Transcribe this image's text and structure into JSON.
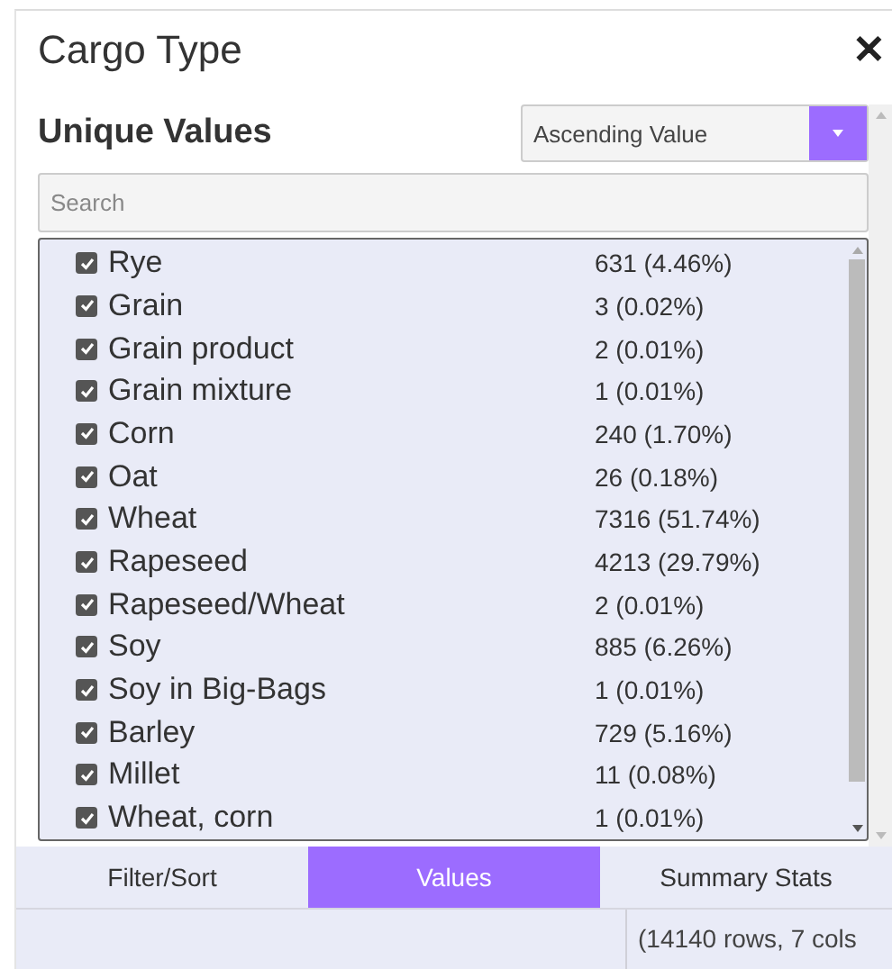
{
  "window": {
    "title": "Cargo Type",
    "close": "✕"
  },
  "header": {
    "title": "Unique Values",
    "sort": {
      "value": "Ascending Value"
    }
  },
  "search": {
    "placeholder": "Search"
  },
  "values": [
    {
      "label": "Rye",
      "count": "631 (4.46%)",
      "checked": true
    },
    {
      "label": "Grain",
      "count": "3 (0.02%)",
      "checked": true
    },
    {
      "label": "Grain product",
      "count": "2 (0.01%)",
      "checked": true
    },
    {
      "label": "Grain mixture",
      "count": "1 (0.01%)",
      "checked": true
    },
    {
      "label": "Corn",
      "count": "240 (1.70%)",
      "checked": true
    },
    {
      "label": "Oat",
      "count": "26 (0.18%)",
      "checked": true
    },
    {
      "label": "Wheat",
      "count": "7316 (51.74%)",
      "checked": true
    },
    {
      "label": "Rapeseed",
      "count": "4213 (29.79%)",
      "checked": true
    },
    {
      "label": "Rapeseed/Wheat",
      "count": "2 (0.01%)",
      "checked": true
    },
    {
      "label": "Soy",
      "count": "885 (6.26%)",
      "checked": true
    },
    {
      "label": "Soy in Big-Bags",
      "count": "1 (0.01%)",
      "checked": true
    },
    {
      "label": "Barley",
      "count": "729 (5.16%)",
      "checked": true
    },
    {
      "label": "Millet",
      "count": "11 (0.08%)",
      "checked": true
    },
    {
      "label": "Wheat, corn",
      "count": "1 (0.01%)",
      "checked": true
    }
  ],
  "tabs": [
    {
      "label": "Filter/Sort",
      "selected": false
    },
    {
      "label": "Values",
      "selected": true
    },
    {
      "label": "Summary Stats",
      "selected": false
    }
  ],
  "status_bar": {
    "text": "(14140 rows, 7 cols"
  }
}
